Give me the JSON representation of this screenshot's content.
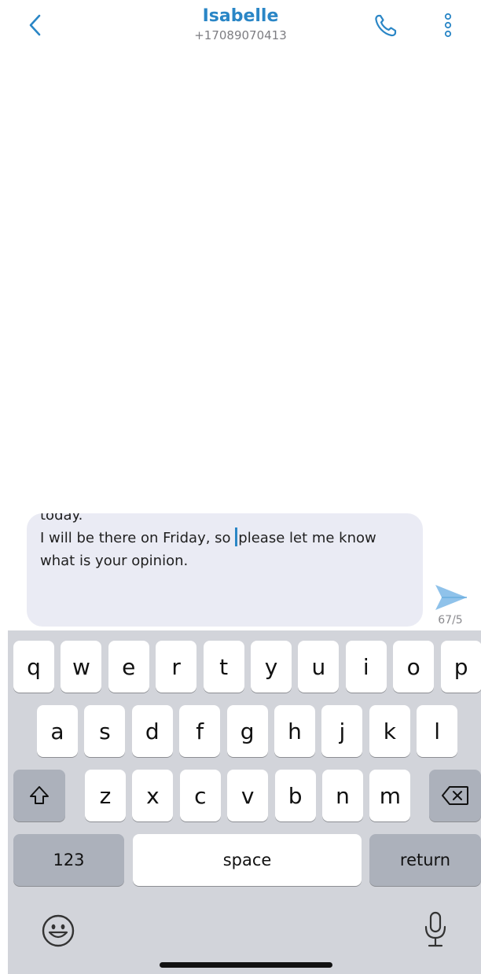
{
  "header": {
    "contact_name": "Isabelle",
    "phone_number": "+17089070413",
    "back_icon": "chevron-left-icon",
    "call_icon": "phone-icon",
    "more_icon": "vertical-dots-icon",
    "accent_color": "#2a86c6"
  },
  "composer": {
    "line_1": "today.",
    "line_2_before_cursor": "I will be there on Friday, so ",
    "line_2_after_cursor": "please let me know",
    "line_3": "what is your opinion.",
    "character_counter": "67/5",
    "send_icon": "send-icon"
  },
  "keyboard": {
    "row1": [
      "q",
      "w",
      "e",
      "r",
      "t",
      "y",
      "u",
      "i",
      "o",
      "p"
    ],
    "row2": [
      "a",
      "s",
      "d",
      "f",
      "g",
      "h",
      "j",
      "k",
      "l"
    ],
    "row3": [
      "z",
      "x",
      "c",
      "v",
      "b",
      "n",
      "m"
    ],
    "shift_icon": "shift-icon",
    "backspace_icon": "backspace-icon",
    "numbers_label": "123",
    "space_label": "space",
    "return_label": "return",
    "emoji_icon": "emoji-icon",
    "mic_icon": "microphone-icon"
  }
}
